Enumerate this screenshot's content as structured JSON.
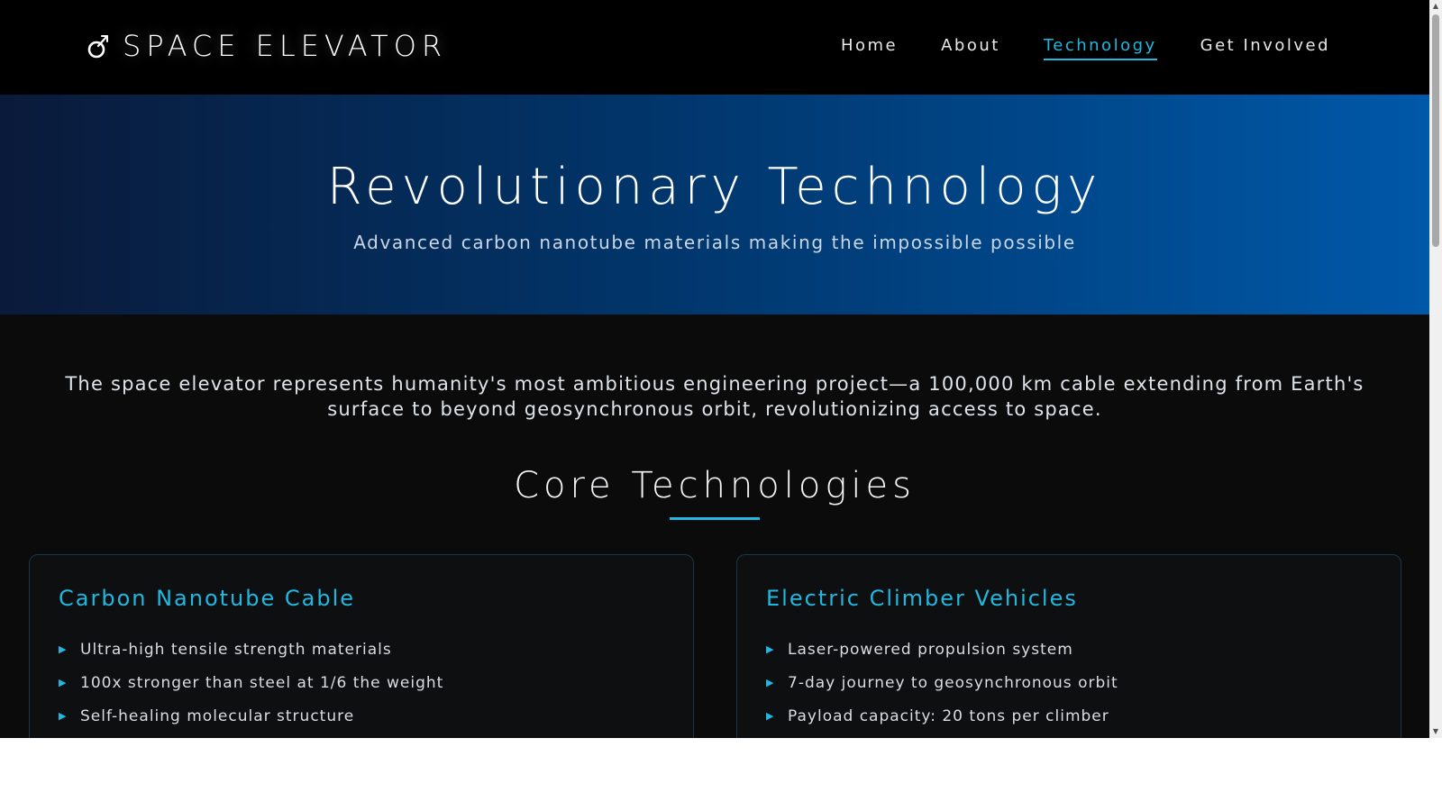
{
  "header": {
    "logo_text": "SPACE ELEVATOR",
    "logo_icon": "rocket-orbit-icon",
    "nav": [
      {
        "label": "Home"
      },
      {
        "label": "About"
      },
      {
        "label": "Technology",
        "active": true
      },
      {
        "label": "Get Involved"
      }
    ]
  },
  "hero": {
    "title": "Revolutionary Technology",
    "subtitle": "Advanced carbon nanotube materials making the impossible possible"
  },
  "intro": {
    "text": "The space elevator represents humanity's most ambitious engineering project—a 100,000 km cable extending from Earth's surface to beyond geosynchronous orbit, revolutionizing access to space."
  },
  "core": {
    "title": "Core Technologies",
    "cards": [
      {
        "title": "Carbon Nanotube Cable",
        "items": [
          "Ultra-high tensile strength materials",
          "100x stronger than steel at 1/6 the weight",
          "Self-healing molecular structure"
        ]
      },
      {
        "title": "Electric Climber Vehicles",
        "items": [
          "Laser-powered propulsion system",
          "7-day journey to geosynchronous orbit",
          "Payload capacity: 20 tons per climber"
        ]
      }
    ]
  },
  "colors": {
    "accent": "#20b8e0",
    "header_bg": "#000000",
    "page_bg": "#0b0b0c",
    "hero_gradient_start": "#0a1a3a",
    "hero_gradient_end": "#0058a8"
  }
}
